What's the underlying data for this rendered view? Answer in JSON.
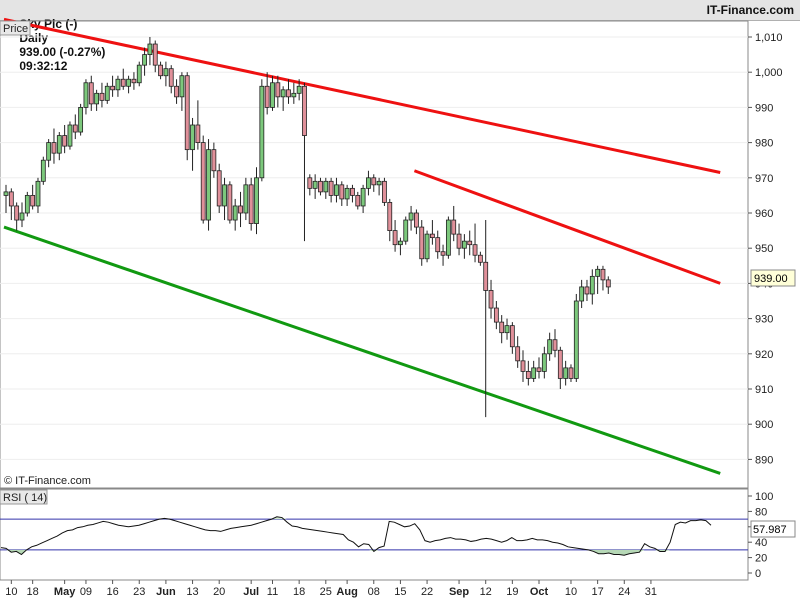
{
  "header": {
    "instrument": "Sky Plc (-)",
    "period": "Daily",
    "last_quote": "939.00 (-0.27%)",
    "time": "09:32:12",
    "brand": "IT-Finance.com"
  },
  "price_panel": {
    "label": "Price",
    "watermark": "© IT-Finance.com",
    "last_label": "939.00"
  },
  "rsi_panel": {
    "label": "RSI ( 14)",
    "value_label": "57.987"
  },
  "colors": {
    "up": "#7cc87c",
    "down": "#e0909a",
    "resistance": "#ee1111",
    "support": "#119911",
    "rsi_band": "#3333aa"
  },
  "chart_data": [
    {
      "type": "candlestick",
      "series_name": "Sky Plc",
      "ylim": [
        882,
        1014
      ],
      "y_ticks": [
        890,
        900,
        910,
        920,
        930,
        940,
        950,
        960,
        970,
        980,
        990,
        1000,
        1010
      ],
      "y_tick_labels": [
        "890",
        "900",
        "910",
        "920",
        "930",
        "940",
        "950",
        "960",
        "970",
        "980",
        "990",
        "1,000",
        "1,010"
      ],
      "x_labels": [
        "10",
        "18",
        "May",
        "09",
        "16",
        "23",
        "Jun",
        "13",
        "20",
        "Jul",
        "11",
        "18",
        "25",
        "Aug",
        "08",
        "15",
        "22",
        "Sep",
        "12",
        "19",
        "Oct",
        "10",
        "17",
        "24",
        "31"
      ],
      "x_label_index": [
        1,
        5,
        11,
        15,
        20,
        25,
        30,
        35,
        40,
        46,
        50,
        55,
        60,
        64,
        69,
        74,
        79,
        85,
        90,
        95,
        100,
        106,
        111,
        116,
        121
      ],
      "candles": [
        {
          "o": 965,
          "h": 968,
          "l": 960,
          "c": 966
        },
        {
          "o": 966,
          "h": 967,
          "l": 958,
          "c": 962
        },
        {
          "o": 962,
          "h": 963,
          "l": 955,
          "c": 958
        },
        {
          "o": 958,
          "h": 963,
          "l": 956,
          "c": 960
        },
        {
          "o": 960,
          "h": 966,
          "l": 959,
          "c": 965
        },
        {
          "o": 965,
          "h": 968,
          "l": 961,
          "c": 962
        },
        {
          "o": 962,
          "h": 970,
          "l": 960,
          "c": 969
        },
        {
          "o": 969,
          "h": 976,
          "l": 968,
          "c": 975
        },
        {
          "o": 975,
          "h": 981,
          "l": 973,
          "c": 980
        },
        {
          "o": 980,
          "h": 984,
          "l": 974,
          "c": 977
        },
        {
          "o": 977,
          "h": 983,
          "l": 975,
          "c": 982
        },
        {
          "o": 982,
          "h": 985,
          "l": 977,
          "c": 979
        },
        {
          "o": 979,
          "h": 986,
          "l": 978,
          "c": 985
        },
        {
          "o": 985,
          "h": 988,
          "l": 981,
          "c": 983
        },
        {
          "o": 983,
          "h": 991,
          "l": 982,
          "c": 990
        },
        {
          "o": 990,
          "h": 998,
          "l": 988,
          "c": 997
        },
        {
          "o": 997,
          "h": 999,
          "l": 989,
          "c": 991
        },
        {
          "o": 991,
          "h": 995,
          "l": 989,
          "c": 994
        },
        {
          "o": 994,
          "h": 997,
          "l": 990,
          "c": 992
        },
        {
          "o": 992,
          "h": 997,
          "l": 991,
          "c": 996
        },
        {
          "o": 996,
          "h": 999,
          "l": 993,
          "c": 995
        },
        {
          "o": 995,
          "h": 999,
          "l": 993,
          "c": 998
        },
        {
          "o": 998,
          "h": 1001,
          "l": 995,
          "c": 996
        },
        {
          "o": 996,
          "h": 999,
          "l": 994,
          "c": 998
        },
        {
          "o": 998,
          "h": 1000,
          "l": 995,
          "c": 997
        },
        {
          "o": 997,
          "h": 1003,
          "l": 996,
          "c": 1002
        },
        {
          "o": 1002,
          "h": 1007,
          "l": 999,
          "c": 1005
        },
        {
          "o": 1005,
          "h": 1010,
          "l": 1002,
          "c": 1008
        },
        {
          "o": 1008,
          "h": 1009,
          "l": 1000,
          "c": 1002
        },
        {
          "o": 1002,
          "h": 1003,
          "l": 998,
          "c": 999
        },
        {
          "o": 999,
          "h": 1003,
          "l": 996,
          "c": 1001
        },
        {
          "o": 1001,
          "h": 1002,
          "l": 994,
          "c": 996
        },
        {
          "o": 996,
          "h": 998,
          "l": 991,
          "c": 993
        },
        {
          "o": 993,
          "h": 1000,
          "l": 989,
          "c": 999
        },
        {
          "o": 999,
          "h": 1000,
          "l": 975,
          "c": 978
        },
        {
          "o": 978,
          "h": 987,
          "l": 972,
          "c": 985
        },
        {
          "o": 985,
          "h": 992,
          "l": 978,
          "c": 980
        },
        {
          "o": 980,
          "h": 982,
          "l": 957,
          "c": 958
        },
        {
          "o": 958,
          "h": 981,
          "l": 955,
          "c": 978
        },
        {
          "o": 978,
          "h": 980,
          "l": 970,
          "c": 972
        },
        {
          "o": 972,
          "h": 974,
          "l": 960,
          "c": 962
        },
        {
          "o": 962,
          "h": 970,
          "l": 958,
          "c": 968
        },
        {
          "o": 968,
          "h": 969,
          "l": 957,
          "c": 958
        },
        {
          "o": 958,
          "h": 964,
          "l": 955,
          "c": 962
        },
        {
          "o": 962,
          "h": 966,
          "l": 956,
          "c": 960
        },
        {
          "o": 960,
          "h": 970,
          "l": 958,
          "c": 968
        },
        {
          "o": 968,
          "h": 970,
          "l": 955,
          "c": 957
        },
        {
          "o": 957,
          "h": 973,
          "l": 954,
          "c": 970
        },
        {
          "o": 970,
          "h": 998,
          "l": 969,
          "c": 996
        },
        {
          "o": 996,
          "h": 1000,
          "l": 988,
          "c": 990
        },
        {
          "o": 990,
          "h": 999,
          "l": 989,
          "c": 997
        },
        {
          "o": 997,
          "h": 999,
          "l": 990,
          "c": 993
        },
        {
          "o": 993,
          "h": 996,
          "l": 989,
          "c": 995
        },
        {
          "o": 995,
          "h": 998,
          "l": 991,
          "c": 993
        },
        {
          "o": 993,
          "h": 997,
          "l": 991,
          "c": 994
        },
        {
          "o": 994,
          "h": 998,
          "l": 992,
          "c": 996
        },
        {
          "o": 996,
          "h": 997,
          "l": 952,
          "c": 982
        },
        {
          "o": 970,
          "h": 971,
          "l": 965,
          "c": 967
        },
        {
          "o": 967,
          "h": 971,
          "l": 964,
          "c": 969
        },
        {
          "o": 969,
          "h": 970,
          "l": 965,
          "c": 966
        },
        {
          "o": 966,
          "h": 970,
          "l": 964,
          "c": 969
        },
        {
          "o": 969,
          "h": 970,
          "l": 963,
          "c": 965
        },
        {
          "o": 965,
          "h": 970,
          "l": 963,
          "c": 968
        },
        {
          "o": 968,
          "h": 969,
          "l": 962,
          "c": 964
        },
        {
          "o": 964,
          "h": 968,
          "l": 962,
          "c": 967
        },
        {
          "o": 967,
          "h": 968,
          "l": 963,
          "c": 965
        },
        {
          "o": 965,
          "h": 966,
          "l": 961,
          "c": 962
        },
        {
          "o": 962,
          "h": 968,
          "l": 960,
          "c": 967
        },
        {
          "o": 967,
          "h": 972,
          "l": 965,
          "c": 970
        },
        {
          "o": 970,
          "h": 971,
          "l": 966,
          "c": 968
        },
        {
          "o": 968,
          "h": 970,
          "l": 965,
          "c": 969
        },
        {
          "o": 969,
          "h": 970,
          "l": 962,
          "c": 963
        },
        {
          "o": 963,
          "h": 964,
          "l": 952,
          "c": 955
        },
        {
          "o": 955,
          "h": 958,
          "l": 949,
          "c": 951
        },
        {
          "o": 951,
          "h": 953,
          "l": 948,
          "c": 952
        },
        {
          "o": 952,
          "h": 959,
          "l": 951,
          "c": 958
        },
        {
          "o": 958,
          "h": 962,
          "l": 955,
          "c": 960
        },
        {
          "o": 960,
          "h": 961,
          "l": 954,
          "c": 956
        },
        {
          "o": 956,
          "h": 958,
          "l": 945,
          "c": 947
        },
        {
          "o": 947,
          "h": 955,
          "l": 946,
          "c": 954
        },
        {
          "o": 954,
          "h": 958,
          "l": 951,
          "c": 953
        },
        {
          "o": 953,
          "h": 955,
          "l": 947,
          "c": 949
        },
        {
          "o": 949,
          "h": 951,
          "l": 945,
          "c": 948
        },
        {
          "o": 948,
          "h": 959,
          "l": 947,
          "c": 958
        },
        {
          "o": 958,
          "h": 962,
          "l": 952,
          "c": 954
        },
        {
          "o": 954,
          "h": 957,
          "l": 948,
          "c": 950
        },
        {
          "o": 950,
          "h": 954,
          "l": 947,
          "c": 952
        },
        {
          "o": 952,
          "h": 955,
          "l": 948,
          "c": 951
        },
        {
          "o": 951,
          "h": 957,
          "l": 946,
          "c": 948
        },
        {
          "o": 948,
          "h": 949,
          "l": 945,
          "c": 946
        },
        {
          "o": 946,
          "h": 958,
          "l": 902,
          "c": 938
        },
        {
          "o": 938,
          "h": 941,
          "l": 930,
          "c": 933
        },
        {
          "o": 933,
          "h": 935,
          "l": 927,
          "c": 929
        },
        {
          "o": 929,
          "h": 931,
          "l": 923,
          "c": 926
        },
        {
          "o": 926,
          "h": 930,
          "l": 924,
          "c": 928
        },
        {
          "o": 928,
          "h": 929,
          "l": 920,
          "c": 922
        },
        {
          "o": 922,
          "h": 925,
          "l": 916,
          "c": 918
        },
        {
          "o": 918,
          "h": 921,
          "l": 912,
          "c": 915
        },
        {
          "o": 915,
          "h": 918,
          "l": 911,
          "c": 913
        },
        {
          "o": 913,
          "h": 918,
          "l": 912,
          "c": 916
        },
        {
          "o": 916,
          "h": 919,
          "l": 913,
          "c": 915
        },
        {
          "o": 915,
          "h": 922,
          "l": 913,
          "c": 920
        },
        {
          "o": 920,
          "h": 926,
          "l": 918,
          "c": 924
        },
        {
          "o": 924,
          "h": 927,
          "l": 919,
          "c": 921
        },
        {
          "o": 921,
          "h": 922,
          "l": 910,
          "c": 913
        },
        {
          "o": 913,
          "h": 918,
          "l": 911,
          "c": 916
        },
        {
          "o": 916,
          "h": 917,
          "l": 912,
          "c": 913
        },
        {
          "o": 913,
          "h": 937,
          "l": 912,
          "c": 935
        },
        {
          "o": 935,
          "h": 941,
          "l": 933,
          "c": 939
        },
        {
          "o": 939,
          "h": 941,
          "l": 935,
          "c": 937
        },
        {
          "o": 937,
          "h": 944,
          "l": 934,
          "c": 942
        },
        {
          "o": 942,
          "h": 945,
          "l": 937,
          "c": 944
        },
        {
          "o": 944,
          "h": 945,
          "l": 938,
          "c": 941
        },
        {
          "o": 941,
          "h": 942,
          "l": 937,
          "c": 939
        }
      ],
      "trend_lines": [
        {
          "name": "upper-resistance",
          "color": "#ee1111",
          "points": [
            [
              0,
              1015
            ],
            [
              134,
              971.5
            ]
          ]
        },
        {
          "name": "lower-resistance",
          "color": "#ee1111",
          "points": [
            [
              77,
              972
            ],
            [
              134,
              940
            ]
          ]
        },
        {
          "name": "support",
          "color": "#119911",
          "points": [
            [
              0,
              956
            ],
            [
              134,
              886
            ]
          ]
        }
      ]
    },
    {
      "type": "line",
      "series_name": "RSI",
      "ylim": [
        -5,
        105
      ],
      "y_ticks": [
        0,
        20,
        40,
        60,
        80,
        100
      ],
      "y_tick_labels": [
        "0",
        "20",
        "40",
        "60",
        "80",
        "100"
      ],
      "bands": [
        70,
        30
      ],
      "values": [
        33,
        32,
        27,
        28,
        24,
        30,
        34,
        36,
        39,
        42,
        45,
        48,
        52,
        55,
        56,
        59,
        60,
        62,
        63,
        65,
        67,
        66,
        64,
        62,
        61,
        60,
        61,
        62,
        64,
        66,
        68,
        70,
        71,
        70,
        68,
        66,
        64,
        62,
        60,
        58,
        56,
        55,
        55,
        54,
        56,
        58,
        59,
        60,
        61,
        62,
        64,
        66,
        68,
        70,
        73,
        72,
        66,
        61,
        60,
        58,
        57,
        56,
        55,
        54,
        53,
        52,
        51,
        50,
        43,
        40,
        34,
        38,
        37,
        28,
        33,
        35,
        67,
        66,
        63,
        60,
        61,
        64,
        56,
        42,
        40,
        42,
        43,
        45,
        46,
        44,
        44,
        43,
        41,
        42,
        44,
        45,
        44,
        42,
        40,
        42,
        46,
        42,
        42,
        43,
        45,
        43,
        43,
        42,
        40,
        39,
        37,
        34,
        33,
        32,
        31,
        30,
        28,
        25,
        25,
        26,
        24,
        24,
        23,
        25,
        26,
        27,
        38,
        34,
        32,
        28,
        28,
        40,
        63,
        66,
        65,
        68,
        68,
        69,
        68,
        62
      ]
    }
  ]
}
